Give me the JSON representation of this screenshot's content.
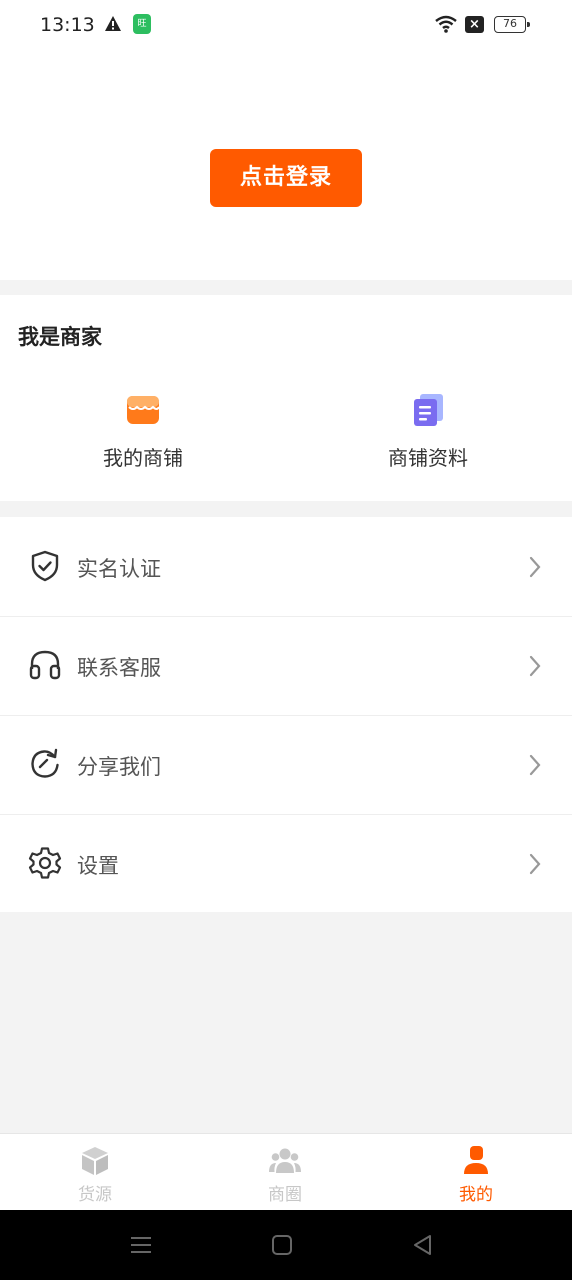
{
  "status_bar": {
    "time": "13:13",
    "app_badge": "旺",
    "battery": "76"
  },
  "header": {
    "login_label": "点击登录",
    "accent_color": "#ff5a00"
  },
  "merchant": {
    "title": "我是商家",
    "items": [
      {
        "label": "我的商铺",
        "icon": "store-icon"
      },
      {
        "label": "商铺资料",
        "icon": "document-icon"
      }
    ]
  },
  "menu": {
    "items": [
      {
        "label": "实名认证",
        "icon": "shield-check-icon"
      },
      {
        "label": "联系客服",
        "icon": "headset-icon"
      },
      {
        "label": "分享我们",
        "icon": "share-refresh-icon"
      },
      {
        "label": "设置",
        "icon": "gear-icon"
      }
    ]
  },
  "tabbar": {
    "items": [
      {
        "label": "货源",
        "icon": "box-icon",
        "active": false
      },
      {
        "label": "商圈",
        "icon": "group-icon",
        "active": false
      },
      {
        "label": "我的",
        "icon": "user-icon",
        "active": true
      }
    ]
  }
}
